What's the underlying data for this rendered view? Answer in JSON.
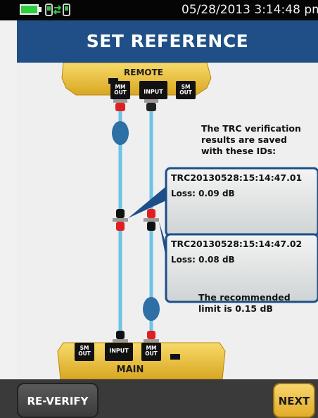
{
  "status_bar": {
    "datetime": "05/28/2013 3:14:48 pm",
    "battery_icon": "battery-icon",
    "connection_icon": "network-connection-icon"
  },
  "header": {
    "title": "SET REFERENCE"
  },
  "remote": {
    "label": "REMOTE",
    "ports": [
      "MM OUT",
      "INPUT",
      "SM OUT"
    ]
  },
  "main": {
    "label": "MAIN",
    "ports": [
      "SM OUT",
      "INPUT",
      "MM OUT"
    ]
  },
  "info": {
    "text_lines": [
      "The TRC verification",
      "results are saved",
      "with these IDs:"
    ],
    "limit_lines": [
      "The recommended",
      "limit is 0.15 dB"
    ]
  },
  "results": [
    {
      "id": "TRC20130528:15:14:47.01",
      "loss": "Loss: 0.09 dB"
    },
    {
      "id": "TRC20130528:15:14:47.02",
      "loss": "Loss: 0.08 dB"
    }
  ],
  "buttons": {
    "reverify": "RE-VERIFY",
    "next": "NEXT"
  },
  "colors": {
    "header": "#1f4f86",
    "fiber": "#6fc3e6",
    "connector_red": "#e02020",
    "device_yellow": "#f2c94c",
    "mandrel_blue": "#2e6fa6"
  }
}
